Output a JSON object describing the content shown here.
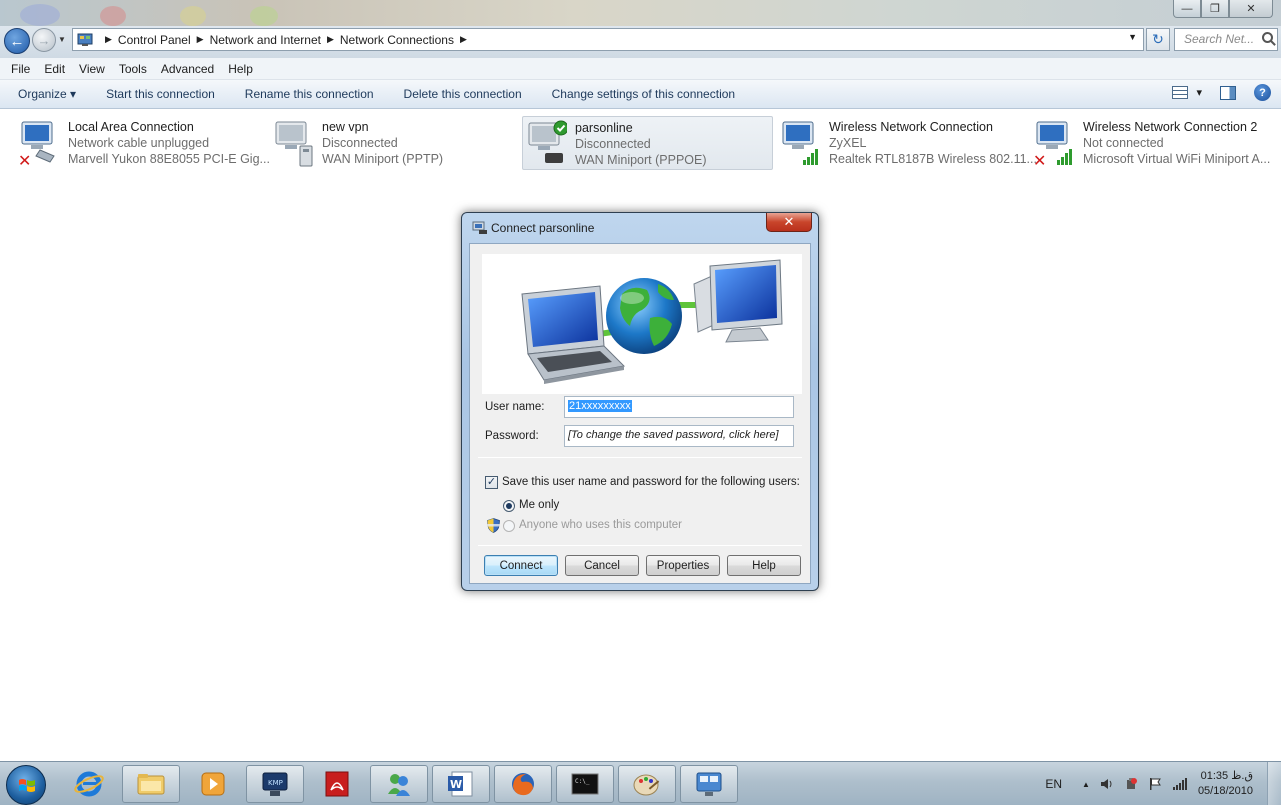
{
  "window": {
    "minimize_glyph": "—",
    "maximize_glyph": "❐",
    "close_glyph": "✕"
  },
  "address": {
    "breadcrumbs": [
      "Control Panel",
      "Network and Internet",
      "Network Connections"
    ],
    "search_placeholder": "Search Net...",
    "back_glyph": "←",
    "forward_glyph": "→",
    "refresh_glyph": "↻"
  },
  "menubar": [
    "File",
    "Edit",
    "View",
    "Tools",
    "Advanced",
    "Help"
  ],
  "commandbar": {
    "organize": "Organize ▾",
    "start": "Start this connection",
    "rename": "Rename this connection",
    "delete": "Delete this connection",
    "change": "Change settings of this connection",
    "view_dropdown": "▾",
    "help_glyph": "?"
  },
  "connections": [
    {
      "name": "Local Area Connection",
      "status": "Network cable unplugged",
      "device": "Marvell Yukon 88E8055 PCI-E Gig...",
      "icon": "lan-disconnected-icon"
    },
    {
      "name": "new vpn",
      "status": "Disconnected",
      "device": "WAN Miniport (PPTP)",
      "icon": "vpn-icon"
    },
    {
      "name": "parsonline",
      "status": "Disconnected",
      "device": "WAN Miniport (PPPOE)",
      "icon": "dialup-default-icon"
    },
    {
      "name": "Wireless Network Connection",
      "status": "ZyXEL",
      "device": "Realtek RTL8187B Wireless 802.11...",
      "icon": "wireless-icon"
    },
    {
      "name": "Wireless Network Connection 2",
      "status": "Not connected",
      "device": "Microsoft Virtual WiFi Miniport A...",
      "icon": "wireless-disconnected-icon"
    }
  ],
  "dialog": {
    "title": "Connect parsonline",
    "close_glyph": "✕",
    "username_label": "User name:",
    "username_value": "21xxxxxxxxx",
    "password_label": "Password:",
    "password_value": "[To change the saved password, click here]",
    "save_label": "Save this user name and password for the following users:",
    "save_checked_glyph": "✓",
    "me_only": "Me only",
    "anyone": "Anyone who uses this computer",
    "buttons": {
      "connect": "Connect",
      "cancel": "Cancel",
      "properties": "Properties",
      "help": "Help"
    }
  },
  "taskbar": {
    "language": "EN",
    "tray_up": "▲",
    "clock_time": "01:35 ق.ظ",
    "clock_date": "05/18/2010"
  },
  "colors": {
    "accent": "#1f5aa8",
    "dialog_frame": "#a9c5e4",
    "close_red": "#c9452b",
    "disconnected_red": "#d11a1a",
    "signal_green": "#2e9b2e"
  }
}
